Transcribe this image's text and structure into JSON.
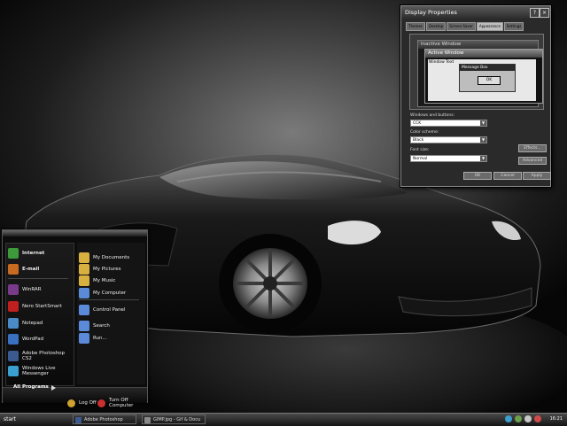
{
  "display_properties": {
    "title": "Display Properties",
    "tabs": [
      "Themes",
      "Desktop",
      "Screen Saver",
      "Appearance",
      "Settings"
    ],
    "active_tab": "Appearance",
    "preview": {
      "inactive_title": "Inactive Window",
      "active_title": "Active Window",
      "window_text": "Window Text",
      "message_title": "Message Box",
      "ok_label": "OK"
    },
    "windows_buttons_label": "Windows and buttons:",
    "windows_buttons_value": "CCK",
    "color_scheme_label": "Color scheme:",
    "color_scheme_value": "Black",
    "font_size_label": "Font size:",
    "font_size_value": "Normal",
    "effects_label": "Effects...",
    "advanced_label": "Advanced",
    "ok_label": "OK",
    "cancel_label": "Cancel",
    "apply_label": "Apply"
  },
  "start_menu": {
    "pinned": [
      {
        "title": "Internet",
        "subtitle": "",
        "icon": "internet-icon",
        "color": "#3c9a3c"
      },
      {
        "title": "E-mail",
        "subtitle": "",
        "icon": "email-icon",
        "color": "#c86a20"
      }
    ],
    "recent": [
      {
        "label": "WinRAR",
        "icon": "winrar-icon",
        "color": "#7a3a8a"
      },
      {
        "label": "Nero StartSmart",
        "icon": "nero-icon",
        "color": "#c02020"
      },
      {
        "label": "Notepad",
        "icon": "notepad-icon",
        "color": "#4a8ac8"
      },
      {
        "label": "WordPad",
        "icon": "wordpad-icon",
        "color": "#3a70c0"
      },
      {
        "label": "Adobe Photoshop CS2",
        "icon": "photoshop-icon",
        "color": "#3a5a90"
      },
      {
        "label": "Windows Live Messenger",
        "icon": "messenger-icon",
        "color": "#3aa0d0"
      }
    ],
    "all_programs": "All Programs",
    "places": [
      {
        "label": "My Documents",
        "icon": "documents-icon",
        "color": "#d8b040"
      },
      {
        "label": "My Pictures",
        "icon": "pictures-icon",
        "color": "#d8b040"
      },
      {
        "label": "My Music",
        "icon": "music-icon",
        "color": "#d8b040"
      },
      {
        "label": "My Computer",
        "icon": "computer-icon",
        "color": "#5a8ad8"
      },
      {
        "label": "Control Panel",
        "icon": "control-panel-icon",
        "color": "#5a8ad8"
      },
      {
        "label": "Search",
        "icon": "search-icon",
        "color": "#5a8ad8"
      },
      {
        "label": "Run...",
        "icon": "run-icon",
        "color": "#5a8ad8"
      }
    ],
    "log_off": "Log Off",
    "turn_off": "Turn Off Computer"
  },
  "taskbar": {
    "start_label": "start",
    "tasks": [
      {
        "label": "Adobe Photoshop",
        "icon": "photoshop-icon",
        "color": "#3a5a90"
      },
      {
        "label": "GIMP.jpg - Gif & Docu",
        "icon": "image-icon",
        "color": "#8a8a8a"
      }
    ],
    "clock": "16:21"
  }
}
